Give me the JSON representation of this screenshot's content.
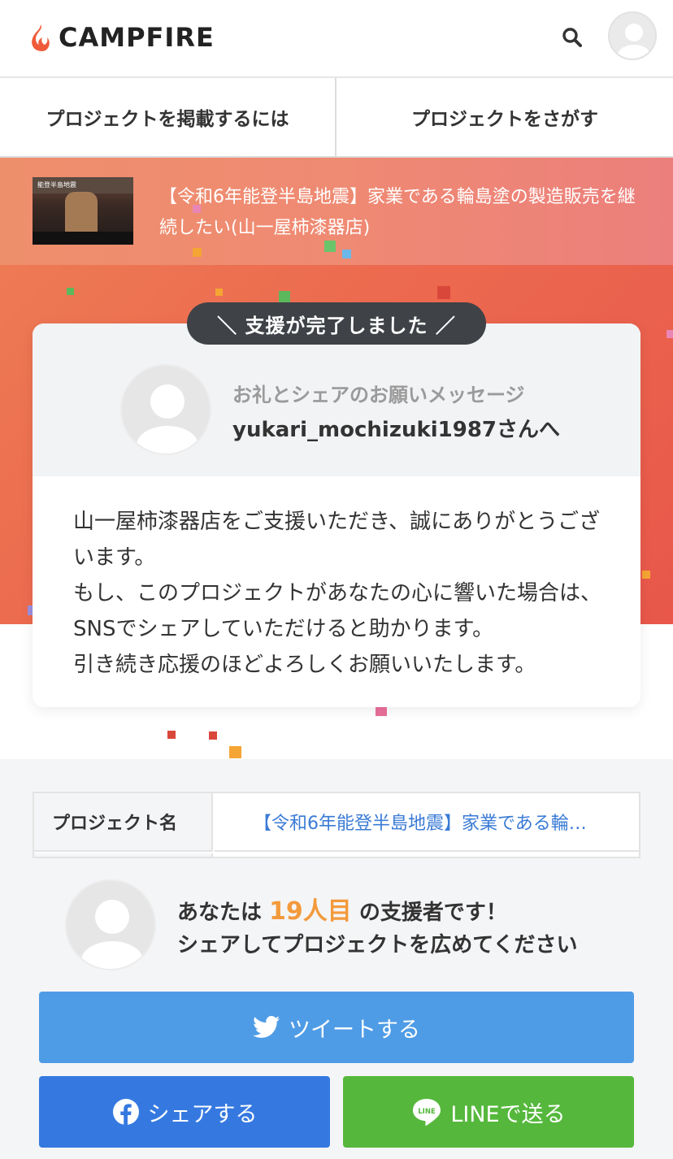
{
  "header": {
    "logo_text": "CAMPFIRE"
  },
  "nav": {
    "post_project": "プロジェクトを掲載するには",
    "find_project": "プロジェクトをさがす"
  },
  "project": {
    "title": "【令和6年能登半島地震】家業である輪島塗の製造販売を継続したい(山一屋柿漆器店)",
    "thumb_caption": "能登半島地震"
  },
  "badge": {
    "label": "＼ 支援が完了しました ／"
  },
  "message": {
    "label": "お礼とシェアのお願いメッセージ",
    "to": "yukari_mochizuki1987さんへ",
    "lines": [
      "山一屋柿漆器店をご支援いただき、誠にありがとうございます。",
      "もし、このプロジェクトがあなたの心に響いた場合は、SNSでシェアしていただけると助かります。",
      "引き続き応援のほどよろしくお願いいたします。"
    ]
  },
  "info": {
    "project_name_label": "プロジェクト名",
    "project_name_value": "【令和6年能登半島地震】家業である輪…"
  },
  "supporter": {
    "prefix": "あなたは ",
    "count": "19人目",
    "suffix": " の支援者です！",
    "cta": "シェアしてプロジェクトを広めてください"
  },
  "share": {
    "tweet": "ツイートする",
    "facebook": "シェアする",
    "line": "LINEで送る"
  },
  "colors": {
    "accent_orange": "#f39a3c",
    "twitter": "#4f9ce6",
    "facebook": "#3579e0",
    "line": "#55b83c",
    "hero": "#ec6a4f"
  },
  "icons": [
    "flame-logo-icon",
    "search-icon",
    "user-avatar-icon",
    "twitter-bird-icon",
    "facebook-icon",
    "line-icon"
  ]
}
